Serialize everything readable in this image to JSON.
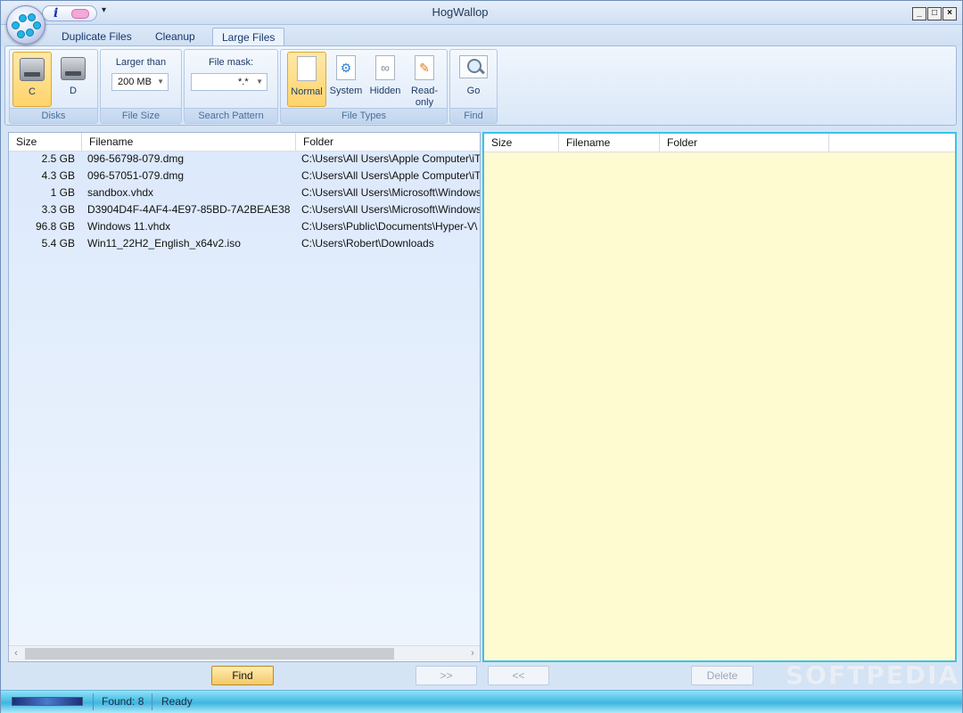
{
  "window": {
    "title": "HogWallop"
  },
  "quick_access": {
    "info_glyph": "i",
    "icons": [
      "info-icon",
      "pill-icon",
      "dropdown-arrow-icon"
    ]
  },
  "window_controls": {
    "minimize": "_",
    "maximize": "□",
    "close": "×"
  },
  "tabs": [
    {
      "label": "Duplicate Files",
      "active": false
    },
    {
      "label": "Cleanup",
      "active": false
    },
    {
      "label": "Large Files",
      "active": true
    }
  ],
  "ribbon": {
    "disks": {
      "label": "Disks",
      "items": [
        {
          "label": "C",
          "selected": true
        },
        {
          "label": "D",
          "selected": false
        }
      ]
    },
    "file_size": {
      "label": "File Size",
      "field_label": "Larger than",
      "value": "200 MB"
    },
    "search_pattern": {
      "label": "Search Pattern",
      "field_label": "File mask:",
      "value": "*.*"
    },
    "file_types": {
      "label": "File Types",
      "items": [
        {
          "label": "Normal",
          "selected": true
        },
        {
          "label": "System",
          "selected": false
        },
        {
          "label": "Hidden",
          "selected": false
        },
        {
          "label": "Read-only",
          "label_line1": "Read-",
          "label_line2": "only",
          "selected": false
        }
      ]
    },
    "find": {
      "label": "Find",
      "button_label": "Go"
    }
  },
  "left_table": {
    "columns": [
      "Size",
      "Filename",
      "Folder"
    ],
    "rows": [
      {
        "size": "2.5 GB",
        "filename": "096-56798-079.dmg",
        "folder": "C:\\Users\\All Users\\Apple Computer\\iT"
      },
      {
        "size": "4.3 GB",
        "filename": "096-57051-079.dmg",
        "folder": "C:\\Users\\All Users\\Apple Computer\\iT"
      },
      {
        "size": "1 GB",
        "filename": "sandbox.vhdx",
        "folder": "C:\\Users\\All Users\\Microsoft\\Windows"
      },
      {
        "size": "3.3 GB",
        "filename": "D3904D4F-4AF4-4E97-85BD-7A2BEAE38",
        "folder": "C:\\Users\\All Users\\Microsoft\\Windows"
      },
      {
        "size": "96.8 GB",
        "filename": "Windows 11.vhdx",
        "folder": "C:\\Users\\Public\\Documents\\Hyper-V\\"
      },
      {
        "size": "5.4 GB",
        "filename": "Win11_22H2_English_x64v2.iso",
        "folder": "C:\\Users\\Robert\\Downloads"
      }
    ]
  },
  "right_table": {
    "columns": [
      "Size",
      "Filename",
      "Folder"
    ],
    "rows": []
  },
  "scrollbar": {
    "left_arrow": "‹",
    "right_arrow": "›"
  },
  "buttons": {
    "find": "Find",
    "move_right": ">>",
    "move_left": "<<",
    "delete": "Delete"
  },
  "watermark": "SOFTPEDIA",
  "statusbar": {
    "found": "Found: 8",
    "status": "Ready",
    "progress_fraction": 1.0
  },
  "colors": {
    "accent_orange": "#f4c968",
    "right_panel_bg": "#fffbd1",
    "right_panel_border": "#3bc3e8",
    "status_bar": "#3fb6e1"
  }
}
